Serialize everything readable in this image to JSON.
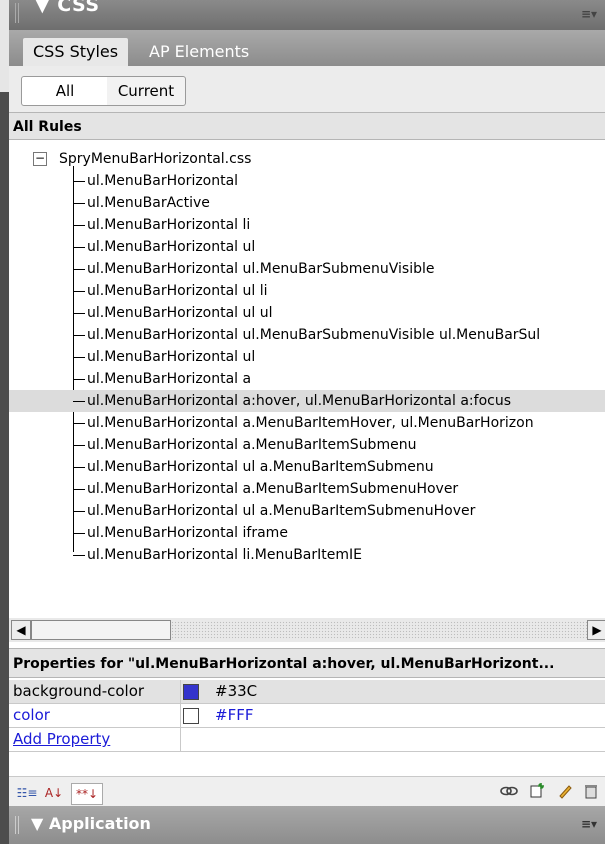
{
  "panel": {
    "title": "▼ CSS",
    "tabs": [
      {
        "label": "CSS Styles"
      },
      {
        "label": "AP Elements"
      }
    ],
    "modes": {
      "all": "All",
      "current": "Current"
    }
  },
  "all_rules": {
    "heading": "All Rules",
    "stylesheet": "SpryMenuBarHorizontal.css",
    "expander": "−",
    "rules": [
      "ul.MenuBarHorizontal",
      "ul.MenuBarActive",
      "ul.MenuBarHorizontal li",
      "ul.MenuBarHorizontal ul",
      "ul.MenuBarHorizontal ul.MenuBarSubmenuVisible",
      "ul.MenuBarHorizontal ul li",
      "ul.MenuBarHorizontal ul ul",
      "ul.MenuBarHorizontal ul.MenuBarSubmenuVisible ul.MenuBarSul",
      "ul.MenuBarHorizontal ul",
      "ul.MenuBarHorizontal a",
      "ul.MenuBarHorizontal a:hover, ul.MenuBarHorizontal a:focus",
      "ul.MenuBarHorizontal a.MenuBarItemHover, ul.MenuBarHorizon",
      "ul.MenuBarHorizontal a.MenuBarItemSubmenu",
      "ul.MenuBarHorizontal ul a.MenuBarItemSubmenu",
      "ul.MenuBarHorizontal a.MenuBarItemSubmenuHover",
      "ul.MenuBarHorizontal ul a.MenuBarItemSubmenuHover",
      "ul.MenuBarHorizontal iframe",
      "ul.MenuBarHorizontal li.MenuBarItemIE"
    ],
    "selected_index": 10
  },
  "scrollbar": {
    "left_arrow": "◀",
    "right_arrow": "▶"
  },
  "properties": {
    "heading": "Properties for \"ul.MenuBarHorizontal a:hover, ul.MenuBarHorizont...",
    "rows": [
      {
        "name": "background-color",
        "value": "#33C",
        "swatch": "#3333cc"
      },
      {
        "name": "color",
        "value": "#FFF",
        "swatch": "#ffffff"
      }
    ],
    "add_property": "Add Property"
  },
  "toolbar": {
    "category_view": "☷≡",
    "alpha_view": "A↓",
    "set_view": "**↓",
    "icons": [
      "attach-icon",
      "new-rule-icon",
      "edit-icon",
      "delete-icon"
    ]
  },
  "application_panel": {
    "title": "▼ Application"
  },
  "colors": {
    "selected_row": "#dcdcdc",
    "link_blue": "#1b1bd8",
    "swatch_blue": "#3333cc"
  }
}
